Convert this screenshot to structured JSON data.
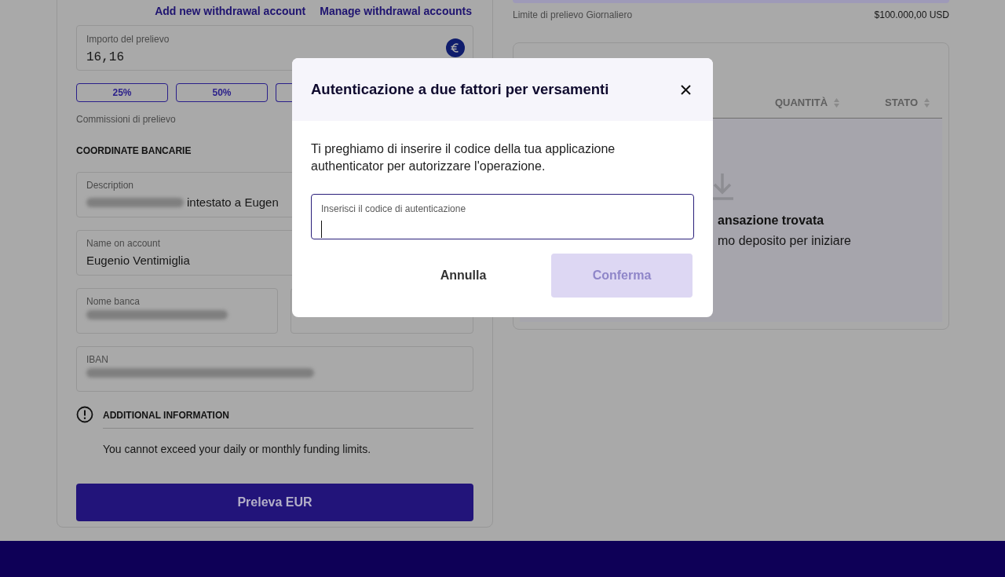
{
  "withdraw_links": [
    "Add new withdrawal account",
    "Manage withdrawal accounts"
  ],
  "amount_field": {
    "label": "Importo del prelievo",
    "value": "16,16"
  },
  "percent_buttons": [
    {
      "label": "25%"
    },
    {
      "label": "50%"
    }
  ],
  "fees_label": "Commissioni di prelievo",
  "bank_section": {
    "title": "COORDINATE BANCARIE",
    "rows": [
      [
        {
          "kind": "field",
          "label": "Description",
          "redacted": true,
          "value": "intestato a Eugen"
        }
      ],
      [
        {
          "kind": "field",
          "label": "Name on account",
          "redacted": false,
          "value": "Eugenio Ventimiglia"
        }
      ],
      [
        {
          "kind": "field",
          "label": "Nome banca",
          "redacted": true
        },
        {
          "kind": "blank"
        }
      ],
      [
        {
          "kind": "field",
          "label": "IBAN",
          "redacted": true
        }
      ]
    ]
  },
  "additional_info": {
    "title": "ADDITIONAL INFORMATION",
    "text": "You cannot exceed your daily or monthly funding limits."
  },
  "submit_button": "Preleva EUR",
  "limit": {
    "label": "Limite di prelievo Giornaliero",
    "value": "$100.000,00 USD"
  },
  "table": {
    "columns": [
      "QUANTITÀ",
      "STATO"
    ],
    "empty_title": "ansazione trovata",
    "empty_text": "mo deposito per iniziare"
  },
  "modal": {
    "title": "Autenticazione a due fattori per versamenti",
    "text": "Ti preghiamo di inserire il codice della tua applicazione authenticator per autorizzare l'operazione.",
    "code_field": {
      "label": "Inserisci il codice di autenticazione"
    },
    "buttons": [
      {
        "label": "Annulla",
        "kind": "text",
        "disabled": false
      },
      {
        "label": "Conferma",
        "kind": "primary",
        "disabled": true
      }
    ]
  }
}
